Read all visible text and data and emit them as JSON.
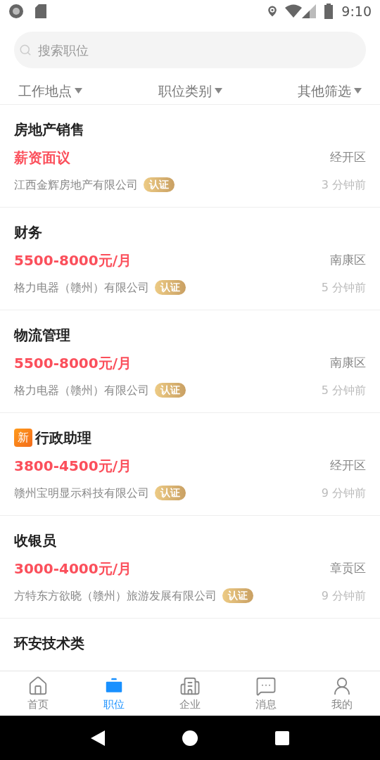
{
  "status_bar": {
    "time": "9:10"
  },
  "search": {
    "placeholder": "搜索职位"
  },
  "filters": [
    {
      "label": "工作地点"
    },
    {
      "label": "职位类别"
    },
    {
      "label": "其他筛选"
    }
  ],
  "jobs": [
    {
      "title": "房地产销售",
      "salary": "薪资面议",
      "district": "经开区",
      "company": "江西金辉房地产有限公司",
      "cert_label": "认证",
      "time": "3 分钟前"
    },
    {
      "title": "财务",
      "salary": "5500-8000元/月",
      "district": "南康区",
      "company": "格力电器（赣州）有限公司",
      "cert_label": "认证",
      "time": "5 分钟前"
    },
    {
      "title": "物流管理",
      "salary": "5500-8000元/月",
      "district": "南康区",
      "company": "格力电器（赣州）有限公司",
      "cert_label": "认证",
      "time": "5 分钟前"
    },
    {
      "title": "行政助理",
      "badge": "新",
      "salary": "3800-4500元/月",
      "district": "经开区",
      "company": "赣州宝明显示科技有限公司",
      "cert_label": "认证",
      "time": "9 分钟前"
    },
    {
      "title": "收银员",
      "salary": "3000-4000元/月",
      "district": "章贡区",
      "company": "方特东方欲晓（赣州）旅游发展有限公司",
      "cert_label": "认证",
      "time": "9 分钟前"
    },
    {
      "title": "环安技术类"
    }
  ],
  "tabs": [
    {
      "label": "首页",
      "kind": "home",
      "selected": false
    },
    {
      "label": "职位",
      "kind": "jobs",
      "selected": true
    },
    {
      "label": "企业",
      "kind": "company",
      "selected": false
    },
    {
      "label": "消息",
      "kind": "messages",
      "selected": false
    },
    {
      "label": "我的",
      "kind": "profile",
      "selected": false
    }
  ]
}
